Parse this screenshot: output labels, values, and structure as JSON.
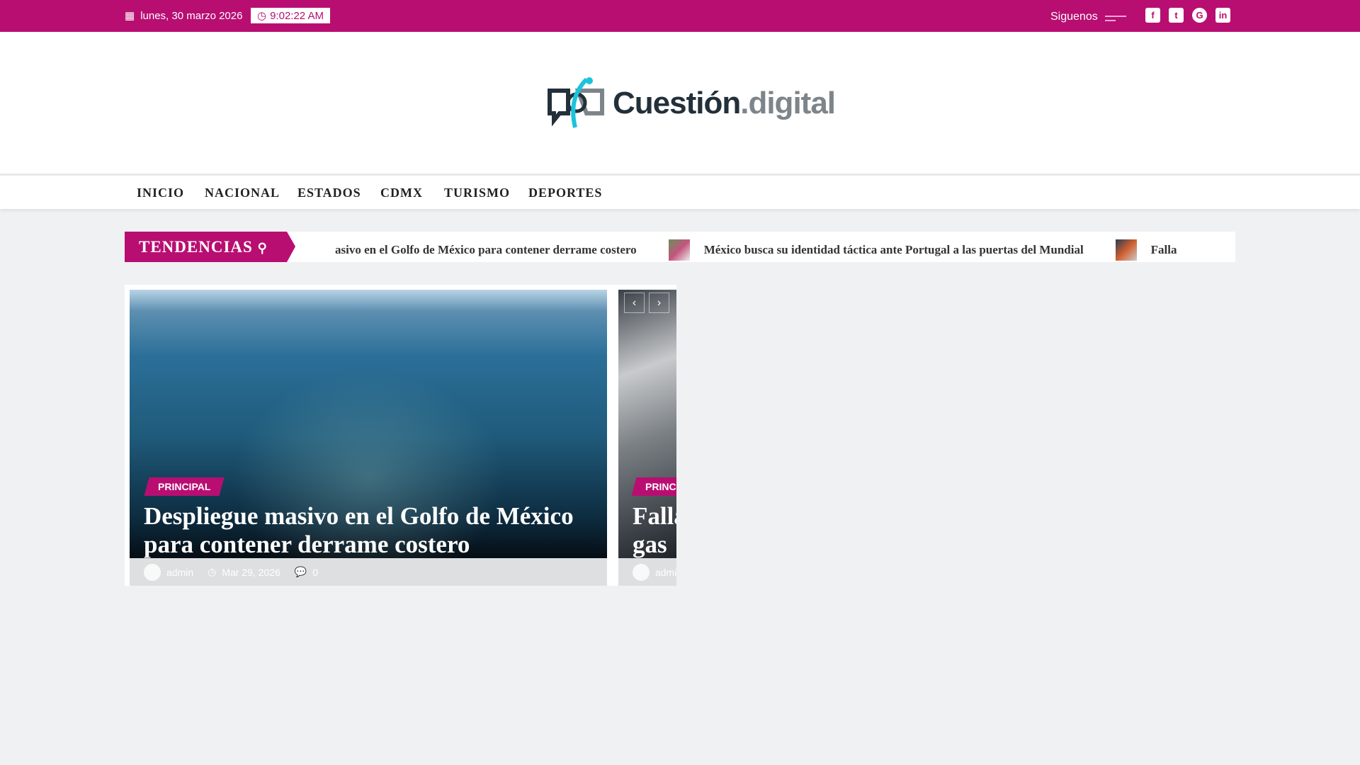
{
  "topbar": {
    "date": "lunes, 30 marzo 2026",
    "time": "9:02:22 AM",
    "follow_label": "Siguenos",
    "social": [
      "facebook-icon",
      "twitter-icon",
      "google-plus-icon",
      "linkedin-icon"
    ]
  },
  "logo": {
    "name": "Cuestión",
    "suffix": ".digital"
  },
  "nav": [
    "INICIO",
    "NACIONAL",
    "ESTADOS",
    "CDMX",
    "TURISMO",
    "DEPORTES"
  ],
  "ticker": {
    "label": "TENDENCIAS",
    "items": [
      "asivo en el Golfo de México para contener derrame costero",
      "México busca su identidad táctica ante Portugal a las puertas del Mundial",
      "Falla"
    ]
  },
  "slides": [
    {
      "category": "PRINCIPAL",
      "title": "Despliegue masivo en el Golfo de México para contener derrame costero",
      "author": "admin",
      "date": "Mar 29, 2026",
      "comments": "0"
    },
    {
      "category": "PRINCIPAL",
      "title": "Falla gas",
      "author": "admin"
    }
  ],
  "colors": {
    "brand": "#b80e72"
  }
}
